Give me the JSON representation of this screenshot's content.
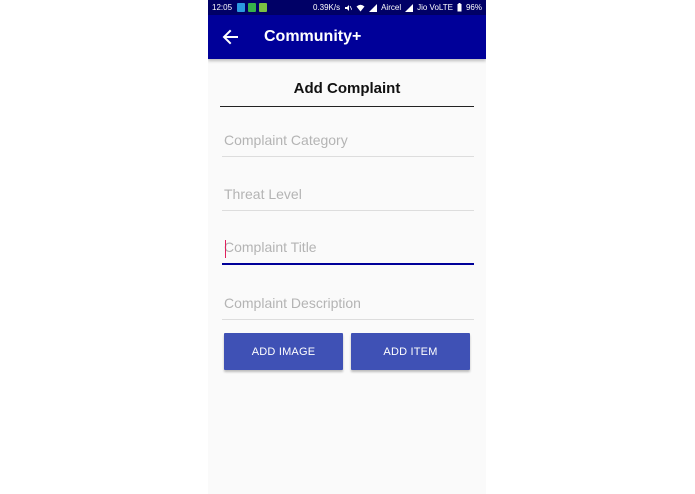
{
  "status_bar": {
    "time": "12:05",
    "net_speed": "0.39K/s",
    "carrier1": "Aircel",
    "carrier2": "Jio VoLTE",
    "battery": "96%"
  },
  "toolbar": {
    "title": "Community+"
  },
  "form": {
    "title": "Add Complaint",
    "category_placeholder": "Complaint Category",
    "threat_placeholder": "Threat Level",
    "complaint_title_placeholder": "Complaint Title",
    "description_placeholder": "Complaint Description",
    "add_image_label": "ADD IMAGE",
    "add_item_label": "ADD ITEM"
  },
  "colors": {
    "status_bar": "#000066",
    "toolbar": "#000099",
    "button": "#3f51b5",
    "cursor": "#e0215d"
  }
}
